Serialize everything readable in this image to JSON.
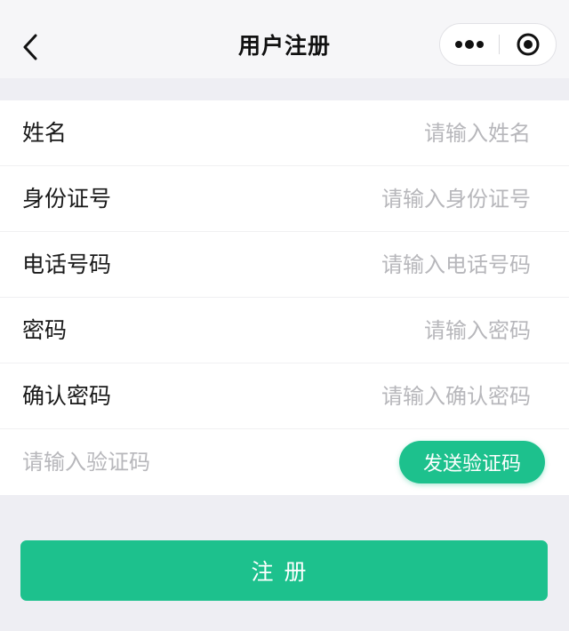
{
  "navbar": {
    "title": "用户注册",
    "back_icon": "chevron-left-icon",
    "more_icon": "more-dots-icon",
    "close_icon": "target-close-icon"
  },
  "form": {
    "fields": [
      {
        "label": "姓名",
        "placeholder": "请输入姓名",
        "value": ""
      },
      {
        "label": "身份证号",
        "placeholder": "请输入身份证号",
        "value": ""
      },
      {
        "label": "电话号码",
        "placeholder": "请输入电话号码",
        "value": ""
      },
      {
        "label": "密码",
        "placeholder": "请输入密码",
        "value": ""
      },
      {
        "label": "确认密码",
        "placeholder": "请输入确认密码",
        "value": ""
      }
    ],
    "verify": {
      "placeholder": "请输入验证码",
      "value": "",
      "send_label": "发送验证码"
    }
  },
  "submit": {
    "label": "注册"
  },
  "colors": {
    "accent": "#1dc18d",
    "background": "#eeeef3",
    "placeholder": "#b7b7bb"
  }
}
